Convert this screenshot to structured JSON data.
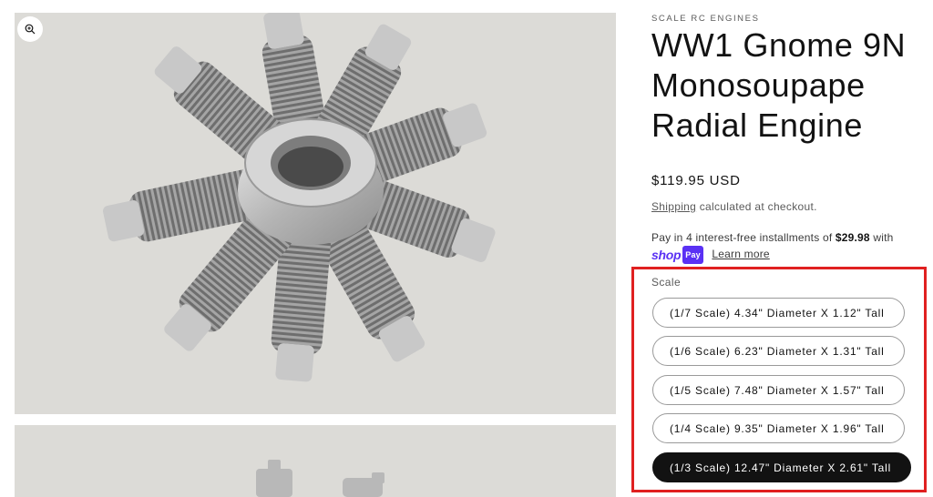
{
  "gallery": {
    "zoom_icon": "magnify-plus-icon"
  },
  "product": {
    "vendor": "SCALE RC ENGINES",
    "title": "WW1 Gnome 9N Monosoupape Radial Engine",
    "price": "$119.95 USD",
    "shipping_link": "Shipping",
    "shipping_text": " calculated at checkout.",
    "installments_text": "Pay in 4 interest-free installments of ",
    "installments_amount": "$29.98",
    "installments_suffix": " with",
    "shoppay_shop": "shop",
    "shoppay_pay": "Pay",
    "learn_more": "Learn more"
  },
  "variant": {
    "label": "Scale",
    "options": [
      "(1/7 Scale) 4.34\" Diameter X 1.12\" Tall",
      "(1/6 Scale) 6.23\" Diameter X 1.31\" Tall",
      "(1/5 Scale) 7.48\" Diameter X 1.57\" Tall",
      "(1/4 Scale) 9.35\" Diameter X 1.96\" Tall",
      "(1/3 Scale) 12.47\" Diameter X 2.61\" Tall"
    ],
    "selected_index": 4
  },
  "colors": {
    "highlight": "#e02020",
    "selected_pill": "#121212",
    "shop_pay": "#5a31f4"
  }
}
